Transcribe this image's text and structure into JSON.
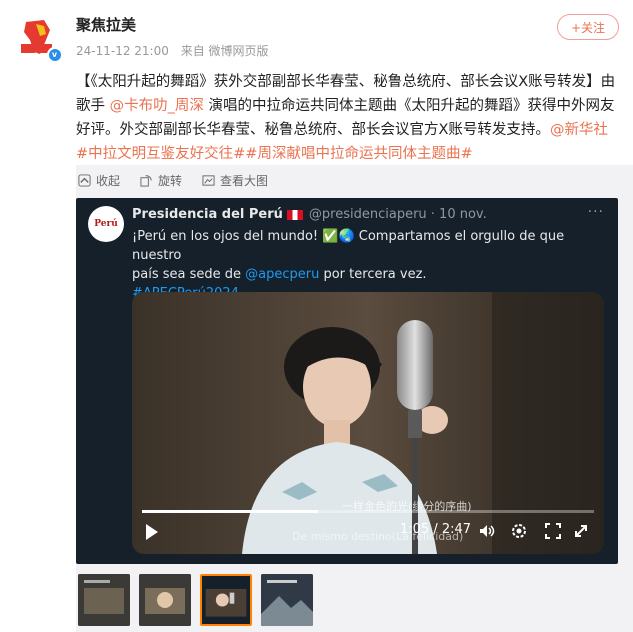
{
  "post": {
    "username": "聚焦拉美",
    "timestamp": "24-11-12 21:00",
    "source": "来自 微博网页版",
    "follow_label": "+关注",
    "text_part1": "【《太阳升起的舞蹈》获外交部副部长华春莹、秘鲁总统府、部长会议X账号转发】由歌手 ",
    "mention_singer": "@卡布叻_周深",
    "text_part2": " 演唱的中拉命运共同体主题曲《太阳升起的舞蹈》获得中外网友好评。外交部副部长华春莹、秘鲁总统府、部长会议官方X账号转发支持。",
    "tags": "@新华社#中拉文明互鉴友好交往##周深献唱中拉命运共同体主题曲#"
  },
  "actions": {
    "collapse": "收起",
    "rotate": "旋转",
    "view_large": "查看大图"
  },
  "tweet": {
    "avatar_text": "Perú",
    "name": "Presidencia del Perú",
    "handle": "@presidenciaperu · 10 nov.",
    "line1": "¡Perú en los ojos del mundo! ✅🌏 Compartamos el orgullo de que nuestro",
    "line2_pre": "país sea sede de ",
    "line2_link": "@apecperu",
    "line2_post": " por tercera vez.",
    "hashtag": "#APECPerú2024",
    "more": "···"
  },
  "video": {
    "timecode": "1:05 / 2:47",
    "progress": 0.39,
    "subtitle_zh": "一样金色的光(缘分的序曲)",
    "subtitle_es": "De mismo destino(La felicidad)"
  },
  "icons": {
    "collapse": "collapse-icon",
    "rotate": "rotate-icon",
    "view": "view-large-icon",
    "play": "play-icon",
    "volume": "volume-icon",
    "settings": "settings-icon",
    "fullscreen": "fullscreen-icon"
  },
  "colors": {
    "accent": "#eb7350",
    "twitter_blue": "#1d9bf0",
    "verified": "#2a8ee8",
    "active_thumb": "#ff8200"
  }
}
